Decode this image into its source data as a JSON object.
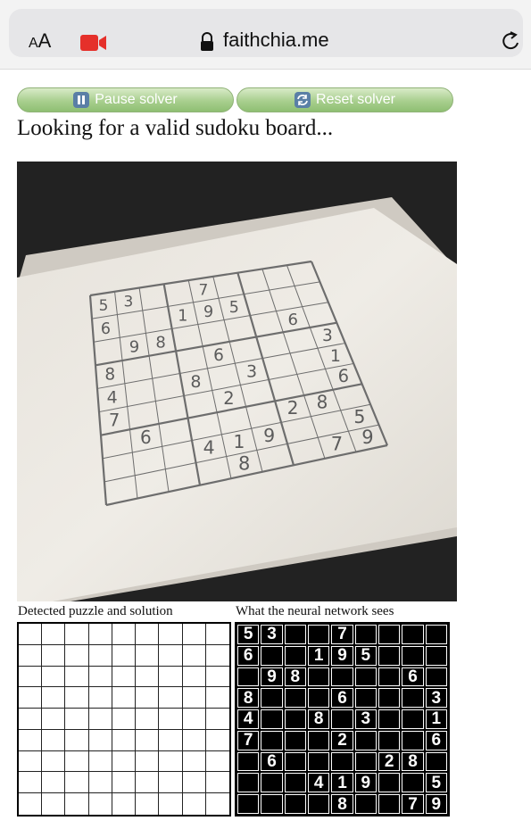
{
  "browser": {
    "aa_small": "A",
    "aa_large": "A",
    "url": "faithchia.me",
    "icons": [
      "video-camera-icon",
      "lock-icon",
      "reload-icon"
    ]
  },
  "controls": {
    "pause_label": "Pause solver",
    "reset_label": "Reset solver"
  },
  "status_text": "Looking for a valid sudoku board...",
  "captions": {
    "left": "Detected puzzle and solution",
    "right": "What the neural network sees"
  },
  "colors": {
    "button_green": "#a8cf8e",
    "record_red": "#e5302a"
  },
  "puzzle_rows": [
    [
      "5",
      "3",
      "",
      "",
      "7",
      "",
      "",
      "",
      ""
    ],
    [
      "6",
      "",
      "",
      "1",
      "9",
      "5",
      "",
      "",
      ""
    ],
    [
      "",
      "9",
      "8",
      "",
      "",
      "",
      "",
      "6",
      ""
    ],
    [
      "8",
      "",
      "",
      "",
      "6",
      "",
      "",
      "",
      "3"
    ],
    [
      "4",
      "",
      "",
      "8",
      "",
      "3",
      "",
      "",
      "1"
    ],
    [
      "7",
      "",
      "",
      "",
      "2",
      "",
      "",
      "",
      "6"
    ],
    [
      "",
      "6",
      "",
      "",
      "",
      "",
      "2",
      "8",
      ""
    ],
    [
      "",
      "",
      "",
      "4",
      "1",
      "9",
      "",
      "",
      "5"
    ],
    [
      "",
      "",
      "",
      "",
      "8",
      "",
      "",
      "7",
      "9"
    ]
  ]
}
